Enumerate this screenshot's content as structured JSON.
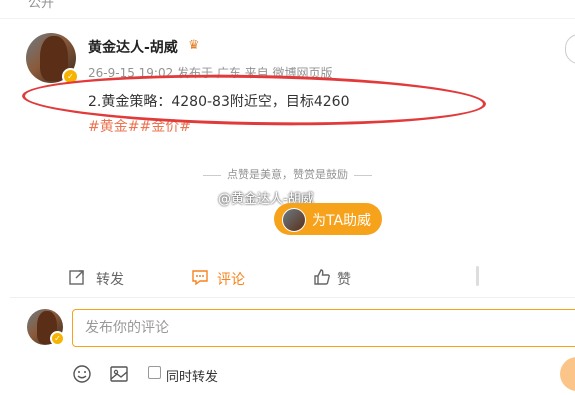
{
  "top": {
    "cut_label": "公开"
  },
  "post": {
    "username": "黄金达人-胡威",
    "meta": "26-9-15 19:02 发布于 广东 来自 微博网页版",
    "text": "2.黄金策略：4280-83附近空，目标4260",
    "hashtags": "#黄金##金价#",
    "annotation_color": "#e23a3a"
  },
  "reward": {
    "hint": "点赞是美意，赞赏是鼓励",
    "watermark": "@黄金达人-胡威",
    "button_label": "为TA助威"
  },
  "actions": {
    "repost": "转发",
    "comment": "评论",
    "like": "赞"
  },
  "composer": {
    "placeholder": "发布你的评论",
    "repost_label": "同时转发"
  },
  "colors": {
    "accent": "#f7a21b",
    "link": "#eb7350",
    "active_tab": "#f7841e"
  }
}
